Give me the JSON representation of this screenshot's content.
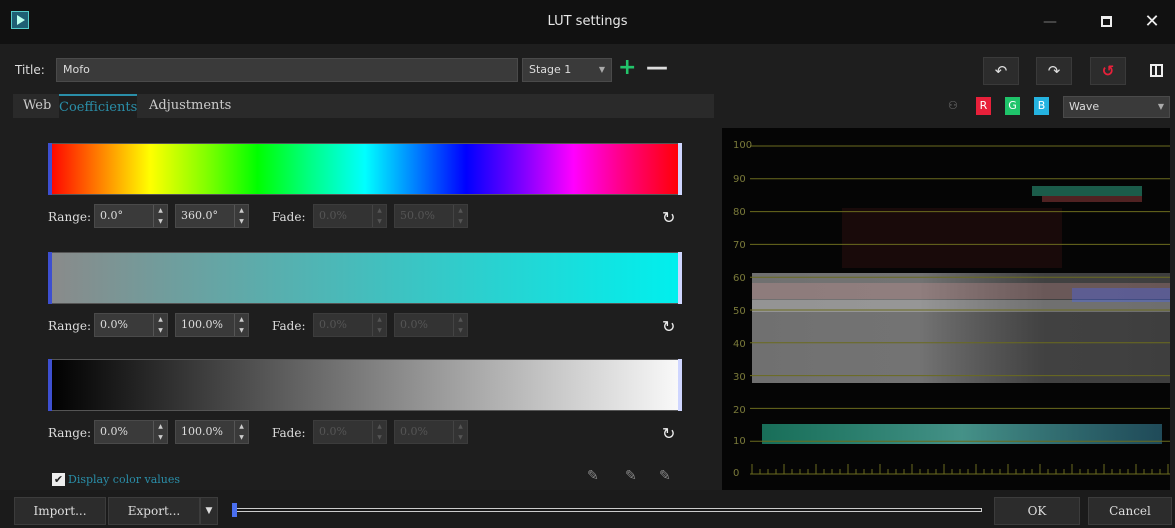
{
  "window": {
    "title": "LUT settings"
  },
  "toolbar": {
    "title_label": "Title:",
    "title_value": "Mofo",
    "stage_value": "Stage 1",
    "add_symbol": "+",
    "remove_symbol": "—"
  },
  "tabs": [
    {
      "label": "Web"
    },
    {
      "label": "Coefficients"
    },
    {
      "label": "Adjustments"
    }
  ],
  "rows": [
    {
      "range_label": "Range:",
      "range_min": "0.0°",
      "range_max": "360.0°",
      "fade_label": "Fade:",
      "fade_min": "0.0%",
      "fade_max": "50.0%"
    },
    {
      "range_label": "Range:",
      "range_min": "0.0%",
      "range_max": "100.0%",
      "fade_label": "Fade:",
      "fade_min": "0.0%",
      "fade_max": "0.0%"
    },
    {
      "range_label": "Range:",
      "range_min": "0.0%",
      "range_max": "100.0%",
      "fade_label": "Fade:",
      "fade_min": "0.0%",
      "fade_max": "0.0%"
    }
  ],
  "display_color_values": {
    "label": "Display color values",
    "checked": true
  },
  "scope": {
    "channels": [
      "R",
      "G",
      "B"
    ],
    "mode": "Wave",
    "y_ticks": [
      "100",
      "90",
      "80",
      "70",
      "60",
      "50",
      "40",
      "30",
      "20",
      "10",
      "0"
    ]
  },
  "buttons": {
    "import": "Import...",
    "export": "Export...",
    "ok": "OK",
    "cancel": "Cancel"
  },
  "colors": {
    "accent": "#2a8ea8",
    "red_channel": "#e8203a",
    "green_channel": "#1fc46a",
    "blue_channel": "#25b3e0",
    "add": "#22c46a"
  }
}
